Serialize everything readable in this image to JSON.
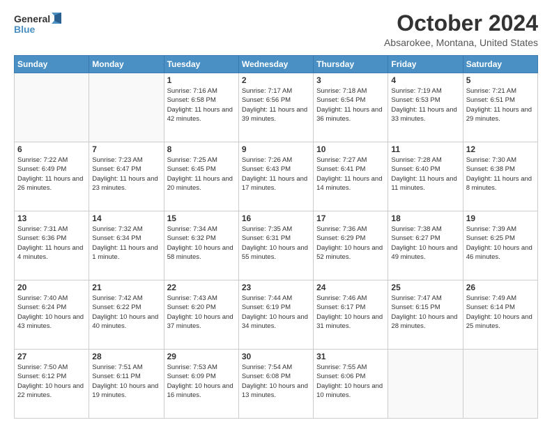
{
  "header": {
    "logo_line1": "General",
    "logo_line2": "Blue",
    "title": "October 2024",
    "subtitle": "Absarokee, Montana, United States"
  },
  "columns": [
    "Sunday",
    "Monday",
    "Tuesday",
    "Wednesday",
    "Thursday",
    "Friday",
    "Saturday"
  ],
  "weeks": [
    [
      {
        "day": "",
        "sunrise": "",
        "sunset": "",
        "daylight": ""
      },
      {
        "day": "",
        "sunrise": "",
        "sunset": "",
        "daylight": ""
      },
      {
        "day": "1",
        "sunrise": "Sunrise: 7:16 AM",
        "sunset": "Sunset: 6:58 PM",
        "daylight": "Daylight: 11 hours and 42 minutes."
      },
      {
        "day": "2",
        "sunrise": "Sunrise: 7:17 AM",
        "sunset": "Sunset: 6:56 PM",
        "daylight": "Daylight: 11 hours and 39 minutes."
      },
      {
        "day": "3",
        "sunrise": "Sunrise: 7:18 AM",
        "sunset": "Sunset: 6:54 PM",
        "daylight": "Daylight: 11 hours and 36 minutes."
      },
      {
        "day": "4",
        "sunrise": "Sunrise: 7:19 AM",
        "sunset": "Sunset: 6:53 PM",
        "daylight": "Daylight: 11 hours and 33 minutes."
      },
      {
        "day": "5",
        "sunrise": "Sunrise: 7:21 AM",
        "sunset": "Sunset: 6:51 PM",
        "daylight": "Daylight: 11 hours and 29 minutes."
      }
    ],
    [
      {
        "day": "6",
        "sunrise": "Sunrise: 7:22 AM",
        "sunset": "Sunset: 6:49 PM",
        "daylight": "Daylight: 11 hours and 26 minutes."
      },
      {
        "day": "7",
        "sunrise": "Sunrise: 7:23 AM",
        "sunset": "Sunset: 6:47 PM",
        "daylight": "Daylight: 11 hours and 23 minutes."
      },
      {
        "day": "8",
        "sunrise": "Sunrise: 7:25 AM",
        "sunset": "Sunset: 6:45 PM",
        "daylight": "Daylight: 11 hours and 20 minutes."
      },
      {
        "day": "9",
        "sunrise": "Sunrise: 7:26 AM",
        "sunset": "Sunset: 6:43 PM",
        "daylight": "Daylight: 11 hours and 17 minutes."
      },
      {
        "day": "10",
        "sunrise": "Sunrise: 7:27 AM",
        "sunset": "Sunset: 6:41 PM",
        "daylight": "Daylight: 11 hours and 14 minutes."
      },
      {
        "day": "11",
        "sunrise": "Sunrise: 7:28 AM",
        "sunset": "Sunset: 6:40 PM",
        "daylight": "Daylight: 11 hours and 11 minutes."
      },
      {
        "day": "12",
        "sunrise": "Sunrise: 7:30 AM",
        "sunset": "Sunset: 6:38 PM",
        "daylight": "Daylight: 11 hours and 8 minutes."
      }
    ],
    [
      {
        "day": "13",
        "sunrise": "Sunrise: 7:31 AM",
        "sunset": "Sunset: 6:36 PM",
        "daylight": "Daylight: 11 hours and 4 minutes."
      },
      {
        "day": "14",
        "sunrise": "Sunrise: 7:32 AM",
        "sunset": "Sunset: 6:34 PM",
        "daylight": "Daylight: 11 hours and 1 minute."
      },
      {
        "day": "15",
        "sunrise": "Sunrise: 7:34 AM",
        "sunset": "Sunset: 6:32 PM",
        "daylight": "Daylight: 10 hours and 58 minutes."
      },
      {
        "day": "16",
        "sunrise": "Sunrise: 7:35 AM",
        "sunset": "Sunset: 6:31 PM",
        "daylight": "Daylight: 10 hours and 55 minutes."
      },
      {
        "day": "17",
        "sunrise": "Sunrise: 7:36 AM",
        "sunset": "Sunset: 6:29 PM",
        "daylight": "Daylight: 10 hours and 52 minutes."
      },
      {
        "day": "18",
        "sunrise": "Sunrise: 7:38 AM",
        "sunset": "Sunset: 6:27 PM",
        "daylight": "Daylight: 10 hours and 49 minutes."
      },
      {
        "day": "19",
        "sunrise": "Sunrise: 7:39 AM",
        "sunset": "Sunset: 6:25 PM",
        "daylight": "Daylight: 10 hours and 46 minutes."
      }
    ],
    [
      {
        "day": "20",
        "sunrise": "Sunrise: 7:40 AM",
        "sunset": "Sunset: 6:24 PM",
        "daylight": "Daylight: 10 hours and 43 minutes."
      },
      {
        "day": "21",
        "sunrise": "Sunrise: 7:42 AM",
        "sunset": "Sunset: 6:22 PM",
        "daylight": "Daylight: 10 hours and 40 minutes."
      },
      {
        "day": "22",
        "sunrise": "Sunrise: 7:43 AM",
        "sunset": "Sunset: 6:20 PM",
        "daylight": "Daylight: 10 hours and 37 minutes."
      },
      {
        "day": "23",
        "sunrise": "Sunrise: 7:44 AM",
        "sunset": "Sunset: 6:19 PM",
        "daylight": "Daylight: 10 hours and 34 minutes."
      },
      {
        "day": "24",
        "sunrise": "Sunrise: 7:46 AM",
        "sunset": "Sunset: 6:17 PM",
        "daylight": "Daylight: 10 hours and 31 minutes."
      },
      {
        "day": "25",
        "sunrise": "Sunrise: 7:47 AM",
        "sunset": "Sunset: 6:15 PM",
        "daylight": "Daylight: 10 hours and 28 minutes."
      },
      {
        "day": "26",
        "sunrise": "Sunrise: 7:49 AM",
        "sunset": "Sunset: 6:14 PM",
        "daylight": "Daylight: 10 hours and 25 minutes."
      }
    ],
    [
      {
        "day": "27",
        "sunrise": "Sunrise: 7:50 AM",
        "sunset": "Sunset: 6:12 PM",
        "daylight": "Daylight: 10 hours and 22 minutes."
      },
      {
        "day": "28",
        "sunrise": "Sunrise: 7:51 AM",
        "sunset": "Sunset: 6:11 PM",
        "daylight": "Daylight: 10 hours and 19 minutes."
      },
      {
        "day": "29",
        "sunrise": "Sunrise: 7:53 AM",
        "sunset": "Sunset: 6:09 PM",
        "daylight": "Daylight: 10 hours and 16 minutes."
      },
      {
        "day": "30",
        "sunrise": "Sunrise: 7:54 AM",
        "sunset": "Sunset: 6:08 PM",
        "daylight": "Daylight: 10 hours and 13 minutes."
      },
      {
        "day": "31",
        "sunrise": "Sunrise: 7:55 AM",
        "sunset": "Sunset: 6:06 PM",
        "daylight": "Daylight: 10 hours and 10 minutes."
      },
      {
        "day": "",
        "sunrise": "",
        "sunset": "",
        "daylight": ""
      },
      {
        "day": "",
        "sunrise": "",
        "sunset": "",
        "daylight": ""
      }
    ]
  ]
}
